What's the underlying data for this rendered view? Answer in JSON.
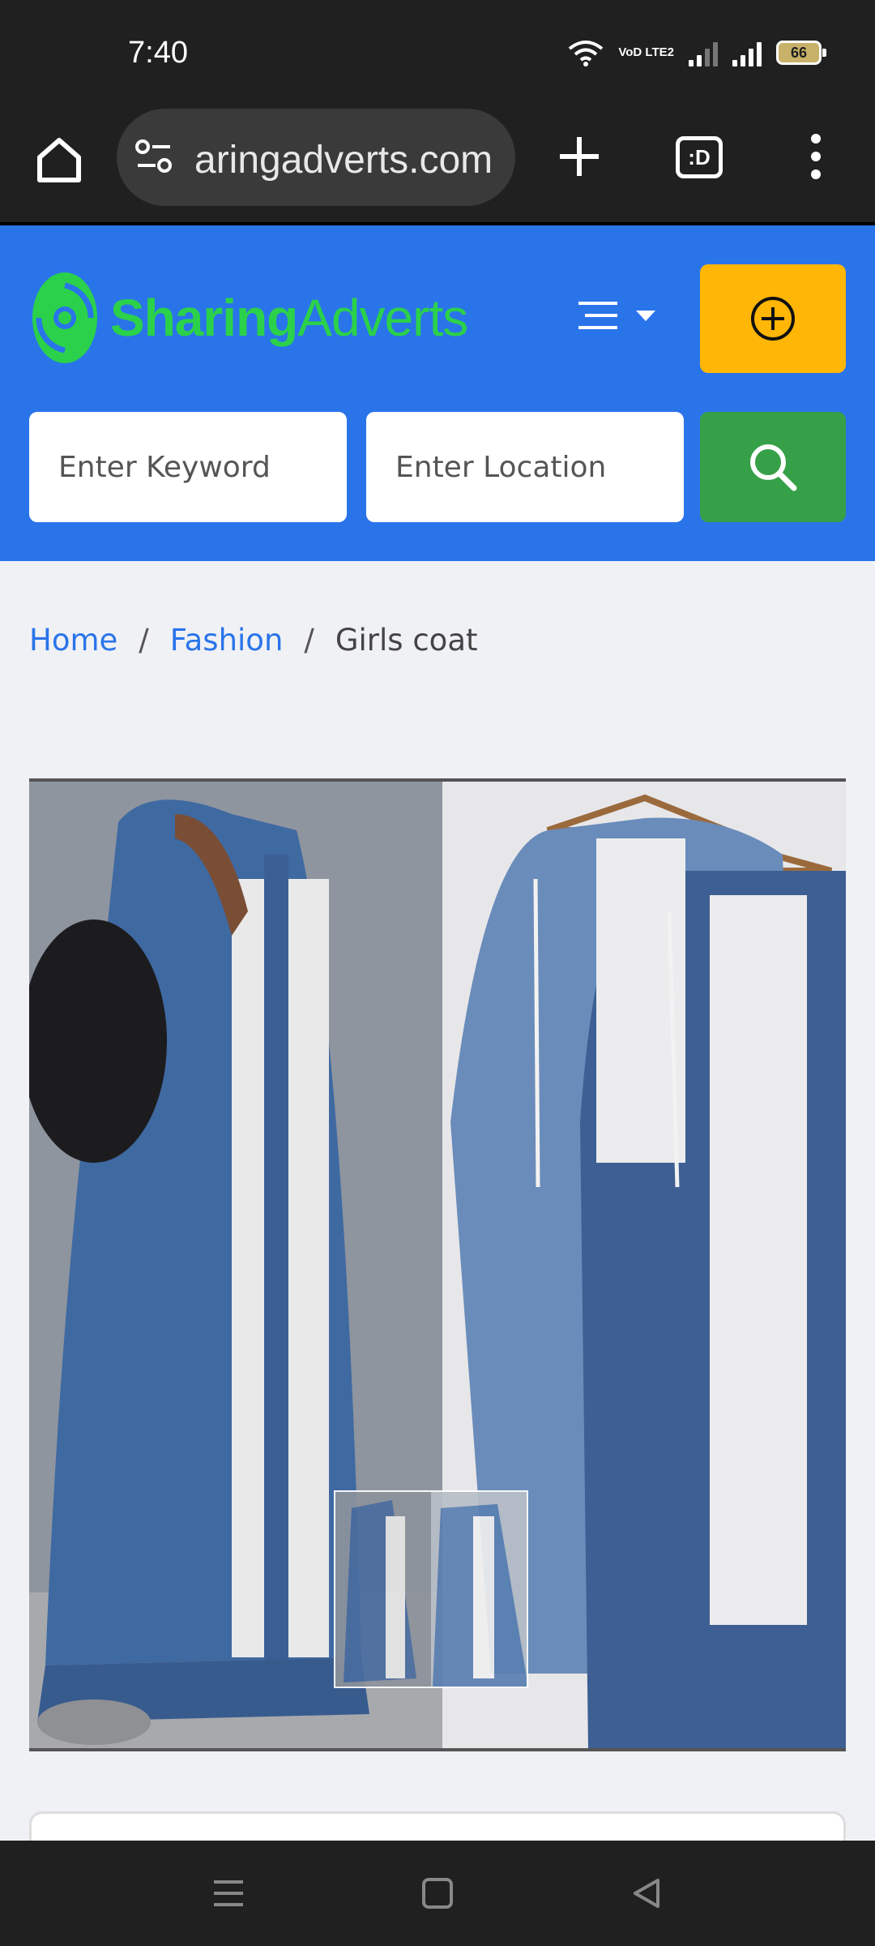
{
  "status_bar": {
    "time": "7:40",
    "carrier_label": "VoD LTE2",
    "battery_level": "66"
  },
  "browser": {
    "url": "aringadverts.com",
    "tabs_label": ":D"
  },
  "site": {
    "logo_bold": "Sharing",
    "logo_light": "Adverts",
    "brand_color": "#2bd14a",
    "header_color": "#2a74ea",
    "post_button_color": "#ffb606",
    "search_button_color": "#35a047",
    "search": {
      "keyword_placeholder": "Enter Keyword",
      "location_placeholder": "Enter Location"
    }
  },
  "breadcrumb": {
    "home": "Home",
    "category": "Fashion",
    "current": "Girls coat"
  },
  "gallery": {
    "image_alt_icon": "product-photo",
    "thumbnail_count": 1
  }
}
